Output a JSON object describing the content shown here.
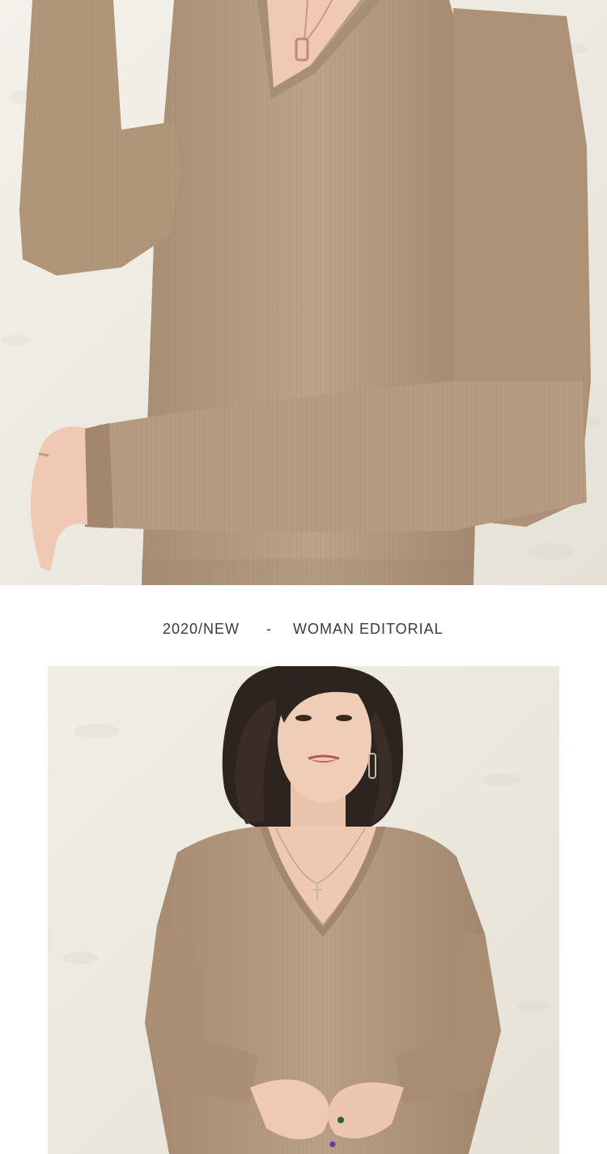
{
  "caption": {
    "left": "2020/NEW",
    "separator": "-",
    "right": "WOMAN EDITORIAL"
  },
  "photos": {
    "top": {
      "subject": "close-up of camel v-neck knit sweater on model"
    },
    "bottom": {
      "subject": "model wearing camel v-neck knit sweater"
    }
  },
  "colors": {
    "wall": "#efece4",
    "sweater": "#b39a81",
    "sweater_shadow": "#9c8268",
    "skin": "#efc9b3",
    "hair": "#2d2420",
    "caption_text": "#3a3a3a"
  }
}
